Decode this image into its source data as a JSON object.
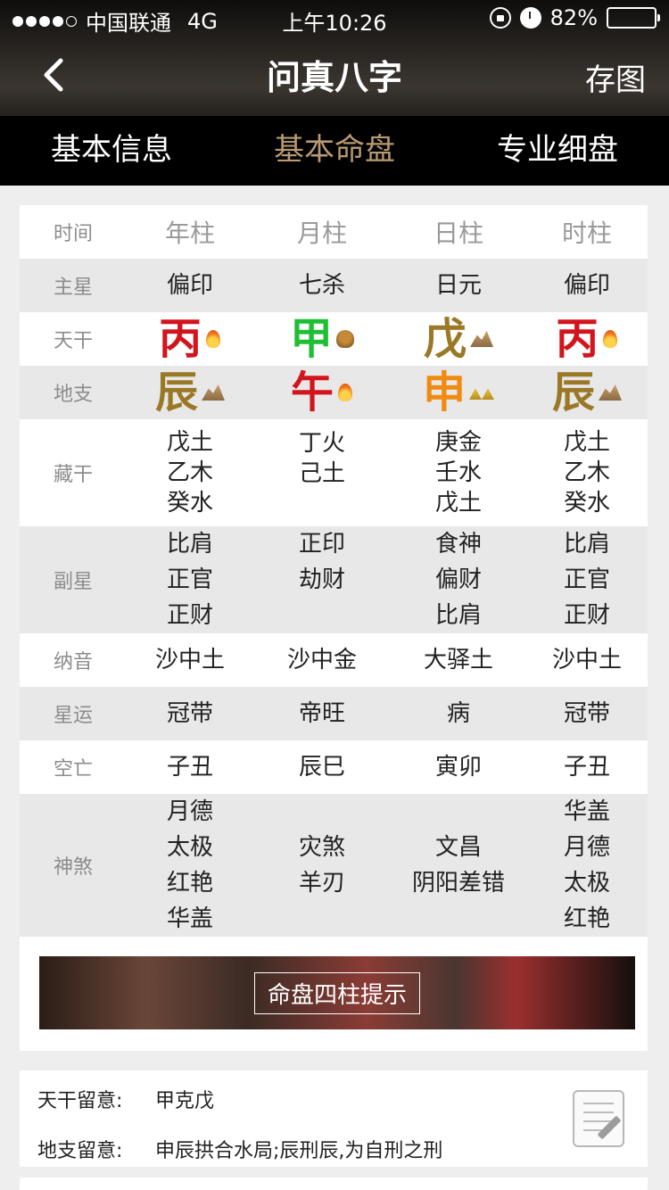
{
  "status_bar": {
    "carrier": "中国联通",
    "network": "4G",
    "time": "上午10:26",
    "battery": "82%",
    "battery_level": 0.82
  },
  "nav": {
    "title": "问真八字",
    "save_label": "存图"
  },
  "tabs": [
    {
      "label": "基本信息",
      "active": false
    },
    {
      "label": "基本命盘",
      "active": true
    },
    {
      "label": "专业细盘",
      "active": false
    }
  ],
  "table": {
    "header": {
      "label": "时间",
      "cols": [
        "年柱",
        "月柱",
        "日柱",
        "时柱"
      ]
    },
    "zhuxing": {
      "label": "主星",
      "cols": [
        "偏印",
        "七杀",
        "日元",
        "偏印"
      ]
    },
    "tiangan": {
      "label": "天干",
      "cols": [
        {
          "char": "丙",
          "color": "#d2141c",
          "element": "fire"
        },
        {
          "char": "甲",
          "color": "#1fbe35",
          "element": "wood"
        },
        {
          "char": "戊",
          "color": "#9a7826",
          "element": "earth"
        },
        {
          "char": "丙",
          "color": "#d2141c",
          "element": "fire"
        }
      ]
    },
    "dizhi": {
      "label": "地支",
      "cols": [
        {
          "char": "辰",
          "color": "#9a7826",
          "element": "earth"
        },
        {
          "char": "午",
          "color": "#d2141c",
          "element": "fire"
        },
        {
          "char": "申",
          "color": "#f08a10",
          "element": "metal"
        },
        {
          "char": "辰",
          "color": "#9a7826",
          "element": "earth"
        }
      ]
    },
    "canggan": {
      "label": "藏干",
      "cols": [
        [
          "戊土",
          "乙木",
          "癸水"
        ],
        [
          "丁火",
          "己土"
        ],
        [
          "庚金",
          "壬水",
          "戊土"
        ],
        [
          "戊土",
          "乙木",
          "癸水"
        ]
      ]
    },
    "fuxing": {
      "label": "副星",
      "cols": [
        [
          "比肩",
          "正官",
          "正财"
        ],
        [
          "正印",
          "劫财"
        ],
        [
          "食神",
          "偏财",
          "比肩"
        ],
        [
          "比肩",
          "正官",
          "正财"
        ]
      ]
    },
    "nayin": {
      "label": "纳音",
      "cols": [
        "沙中土",
        "沙中金",
        "大驿土",
        "沙中土"
      ]
    },
    "xingyun": {
      "label": "星运",
      "cols": [
        "冠带",
        "帝旺",
        "病",
        "冠带"
      ]
    },
    "kongwang": {
      "label": "空亡",
      "cols": [
        "子丑",
        "辰巳",
        "寅卯",
        "子丑"
      ]
    },
    "shensha": {
      "label": "神煞",
      "cols": [
        [
          "月德",
          "太极",
          "红艳",
          "华盖"
        ],
        [
          "灾煞",
          "羊刃"
        ],
        [
          "文昌",
          "阴阳差错"
        ],
        [
          "华盖",
          "月德",
          "太极",
          "红艳"
        ]
      ]
    }
  },
  "banner": {
    "label": "命盘四柱提示"
  },
  "notes": {
    "tiangan_key": "天干留意:",
    "tiangan_value": "甲克戊",
    "dizhi_key": "地支留意:",
    "dizhi_value": "申辰拱合水局;辰刑辰,为自刑之刑"
  }
}
